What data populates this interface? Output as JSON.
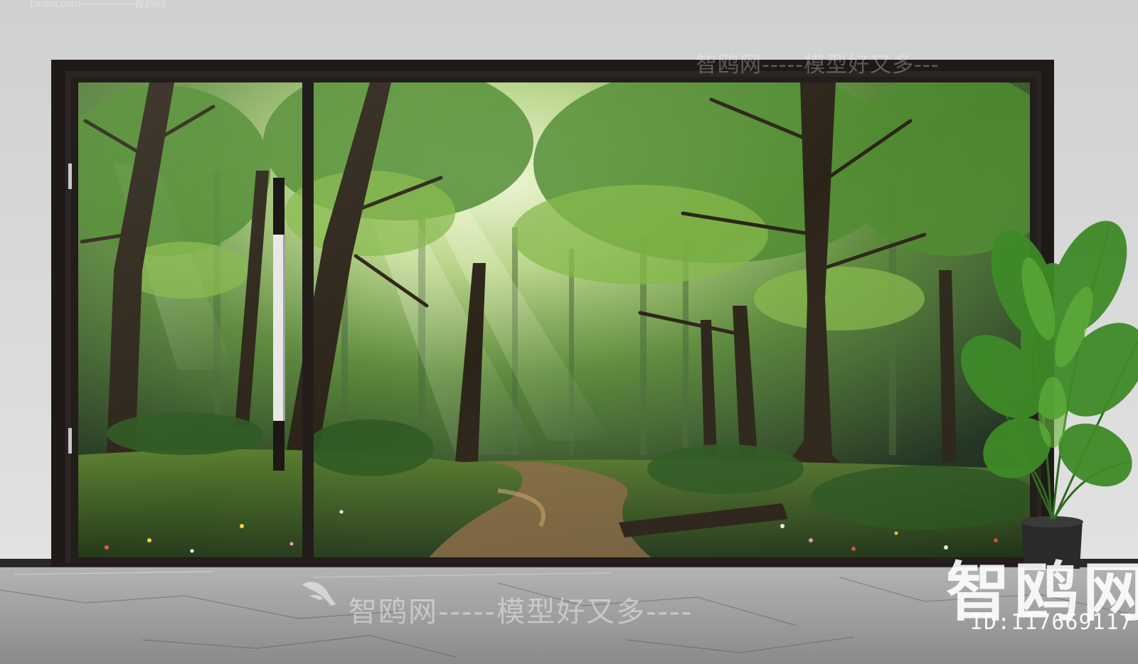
{
  "watermarks": {
    "site": "1miba.com—————智鸥网",
    "top_right": "智鸥网-----模型好又多---",
    "bottom_center": "智鸥网-----模型好又多----",
    "big_brand": "智鸥网",
    "id_text": "ID:117669117"
  },
  "colors": {
    "wall": "#d7d8d8",
    "frame": "#1f1a18",
    "floor": "#9c9c9c",
    "forest_light": "#cfe3a8",
    "forest_dark": "#2a3a22",
    "path": "#8a6a45"
  },
  "icons": {
    "bird_logo": "seagull-logo-icon"
  }
}
